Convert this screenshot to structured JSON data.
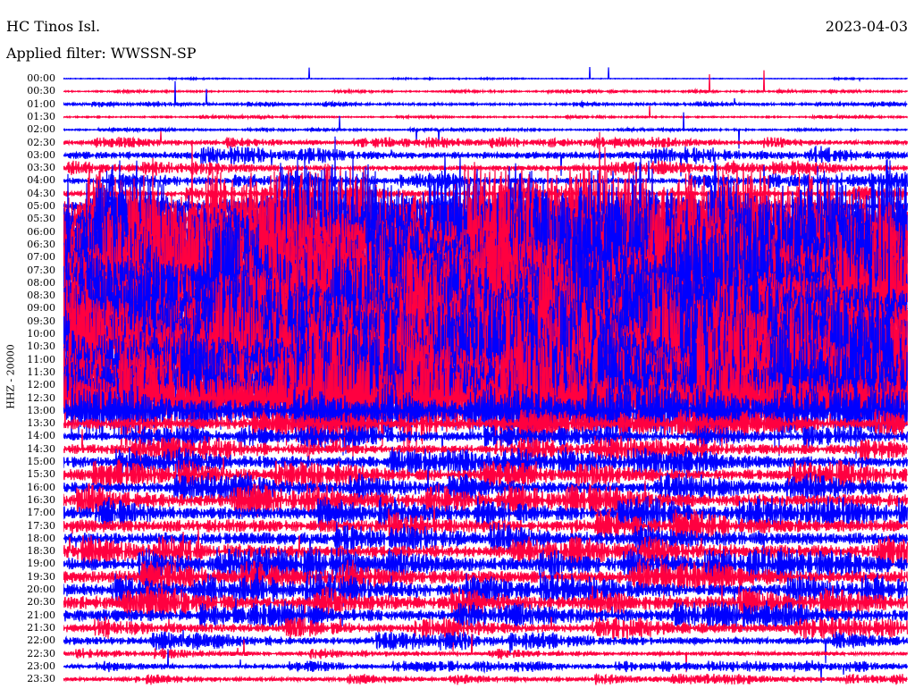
{
  "header": {
    "station": "HC Tinos Isl.",
    "filter": "Applied filter: WWSSN-SP",
    "date": "2023-04-03"
  },
  "chart_data": {
    "type": "line",
    "title": "HC Tinos Isl.",
    "subtitle": "Applied filter: WWSSN-SP",
    "ylabel": "HHZ - 20000",
    "xlabel": "",
    "series_colors": [
      "#0000ff",
      "#ff0040"
    ],
    "rows": [
      "00:00",
      "00:30",
      "01:00",
      "01:30",
      "02:00",
      "02:30",
      "03:00",
      "03:30",
      "04:00",
      "04:30",
      "05:00",
      "05:30",
      "06:00",
      "06:30",
      "07:00",
      "07:30",
      "08:00",
      "08:30",
      "09:00",
      "09:30",
      "10:00",
      "10:30",
      "11:00",
      "11:30",
      "12:00",
      "12:30",
      "13:00",
      "13:30",
      "14:00",
      "14:30",
      "15:00",
      "15:30",
      "16:00",
      "16:30",
      "17:00",
      "17:30",
      "18:00",
      "18:30",
      "19:00",
      "19:30",
      "20:00",
      "20:30",
      "21:00",
      "21:30",
      "22:00",
      "22:30",
      "23:00",
      "23:30"
    ],
    "relative_amplitude": [
      0.05,
      0.1,
      0.15,
      0.1,
      0.1,
      0.3,
      0.5,
      0.4,
      0.4,
      0.4,
      0.6,
      3,
      4,
      4,
      4,
      4,
      4,
      4,
      4,
      4,
      4,
      4,
      4,
      4,
      4,
      3.5,
      1.5,
      0.8,
      0.6,
      0.7,
      0.8,
      0.8,
      0.8,
      0.9,
      0.9,
      0.9,
      0.9,
      0.9,
      0.9,
      0.9,
      0.9,
      0.9,
      0.8,
      0.6,
      0.5,
      0.3,
      0.3,
      0.3
    ]
  }
}
